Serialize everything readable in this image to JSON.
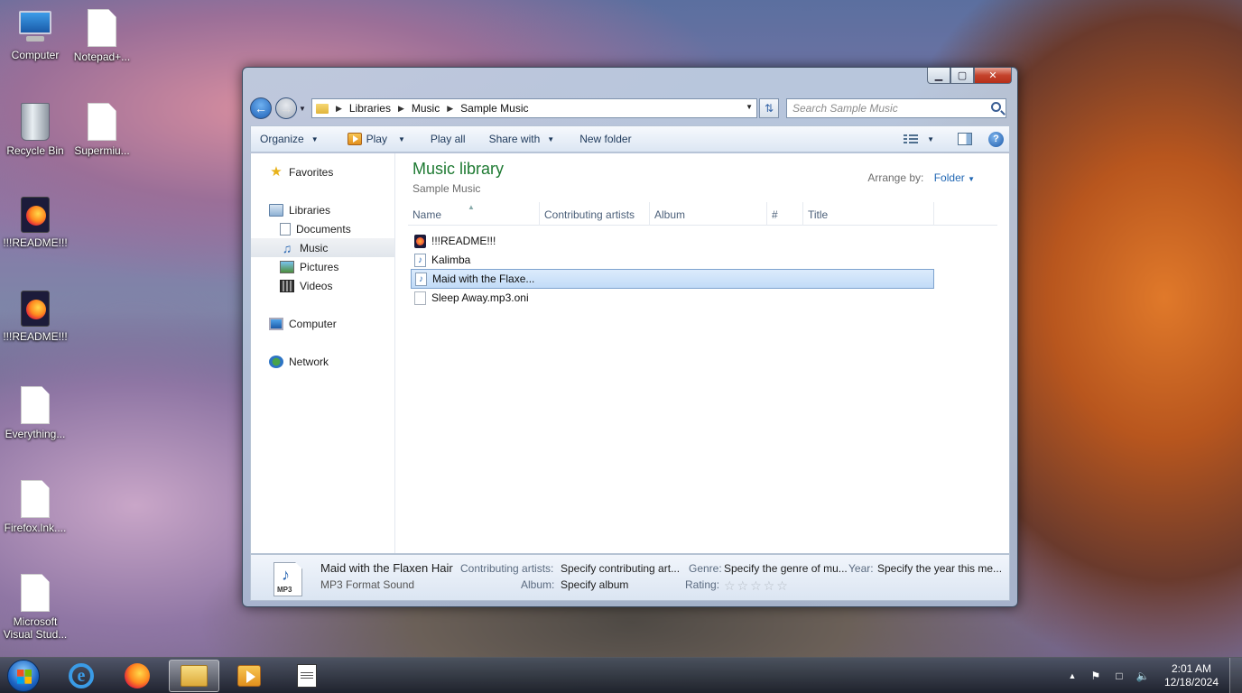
{
  "desktop": {
    "icons": [
      {
        "label": "Computer",
        "icon": "computer-icon"
      },
      {
        "label": "Notepad+...",
        "icon": "document-icon"
      },
      {
        "label": "Recycle Bin",
        "icon": "recycle-bin-icon"
      },
      {
        "label": "Supermiu...",
        "icon": "document-icon"
      },
      {
        "label": "!!!README!!!",
        "icon": "firefox-html-icon"
      },
      {
        "label": "!!!README!!!",
        "icon": "firefox-html-icon"
      },
      {
        "label": "Everything...",
        "icon": "document-icon"
      },
      {
        "label": "Firefox.lnk....",
        "icon": "document-icon"
      },
      {
        "label": "Microsoft Visual Stud...",
        "icon": "document-icon"
      }
    ]
  },
  "window": {
    "caption_buttons": {
      "minimize": "▁",
      "maximize": "▢",
      "close": "✕"
    },
    "breadcrumb": [
      "Libraries",
      "Music",
      "Sample Music"
    ],
    "search_placeholder": "Search Sample Music",
    "toolbar": {
      "organize": "Organize",
      "play": "Play",
      "play_all": "Play all",
      "share_with": "Share with",
      "new_folder": "New folder"
    },
    "nav_pane": {
      "favorites": "Favorites",
      "libraries": "Libraries",
      "documents": "Documents",
      "music": "Music",
      "pictures": "Pictures",
      "videos": "Videos",
      "computer": "Computer",
      "network": "Network",
      "selected": "Music"
    },
    "library": {
      "title": "Music library",
      "subtitle": "Sample Music",
      "arrange_label": "Arrange by:",
      "arrange_value": "Folder"
    },
    "columns": [
      "Name",
      "Contributing artists",
      "Album",
      "#",
      "Title"
    ],
    "files": [
      {
        "name": "!!!README!!!",
        "icon": "firefox-html-icon",
        "selected": false
      },
      {
        "name": "Kalimba",
        "icon": "music-file-icon",
        "selected": false
      },
      {
        "name": "Maid with the Flaxe...",
        "icon": "music-file-icon",
        "selected": true
      },
      {
        "name": "Sleep Away.mp3.oni",
        "icon": "blank-file-icon",
        "selected": false
      }
    ],
    "details": {
      "name": "Maid with the Flaxen Hair",
      "type": "MP3 Format Sound",
      "thumb_label": "MP3",
      "contributing_artists_label": "Contributing artists:",
      "contributing_artists_value": "Specify contributing art...",
      "album_label": "Album:",
      "album_value": "Specify album",
      "genre_label": "Genre:",
      "genre_value": "Specify the genre of mu...",
      "rating_label": "Rating:",
      "rating_stars": "☆☆☆☆☆",
      "year_label": "Year:",
      "year_value": "Specify the year this me..."
    }
  },
  "taskbar": {
    "apps": [
      "start-orb",
      "internet-explorer",
      "firefox",
      "windows-explorer",
      "windows-media-player",
      "notepad"
    ],
    "active_app": "windows-explorer",
    "clock": {
      "time": "2:01 AM",
      "date": "12/18/2024"
    }
  }
}
